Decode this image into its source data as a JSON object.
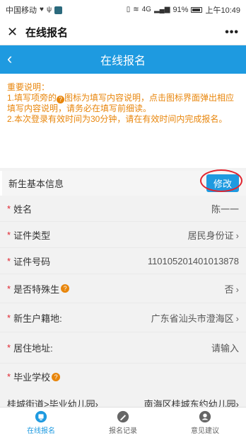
{
  "status": {
    "carrier": "中国移动",
    "signal_text": "4G",
    "battery": "91%",
    "time": "上午10:49"
  },
  "wechat": {
    "title": "在线报名"
  },
  "app": {
    "title": "在线报名"
  },
  "notice": {
    "heading": "重要说明：",
    "line1_pre": "1.填写项旁的",
    "line1_post": "图标为填写内容说明，点击图标界面弹出相应填写内容说明，请务必在填写前细读。",
    "line2": "2.本次登录有效时间为30分钟，请在有效时间内完成报名。"
  },
  "section": {
    "title": "新生基本信息",
    "edit_label": "修改"
  },
  "fields": {
    "name": {
      "label": "姓名",
      "value": "陈一一"
    },
    "id_type": {
      "label": "证件类型",
      "value": "居民身份证"
    },
    "id_number": {
      "label": "证件号码",
      "value": "110105201401013878"
    },
    "special": {
      "label": "是否特殊生",
      "value": "否"
    },
    "hukou": {
      "label": "新生户籍地:",
      "value": "广东省汕头市澄海区"
    },
    "address": {
      "label": "居住地址:",
      "value": "请输入"
    },
    "school": {
      "label": "毕业学校"
    }
  },
  "school_select": {
    "street": "桂城街道>毕业幼儿园",
    "kindergarten": "南海区桂城东约幼儿园"
  },
  "tabs": [
    {
      "label": "在线报名",
      "icon": "apply-icon"
    },
    {
      "label": "报名记录",
      "icon": "record-icon"
    },
    {
      "label": "意见建议",
      "icon": "feedback-icon"
    }
  ],
  "colors": {
    "primary": "#1e9ae0",
    "notice": "#e8860c",
    "required": "#e0242f"
  }
}
